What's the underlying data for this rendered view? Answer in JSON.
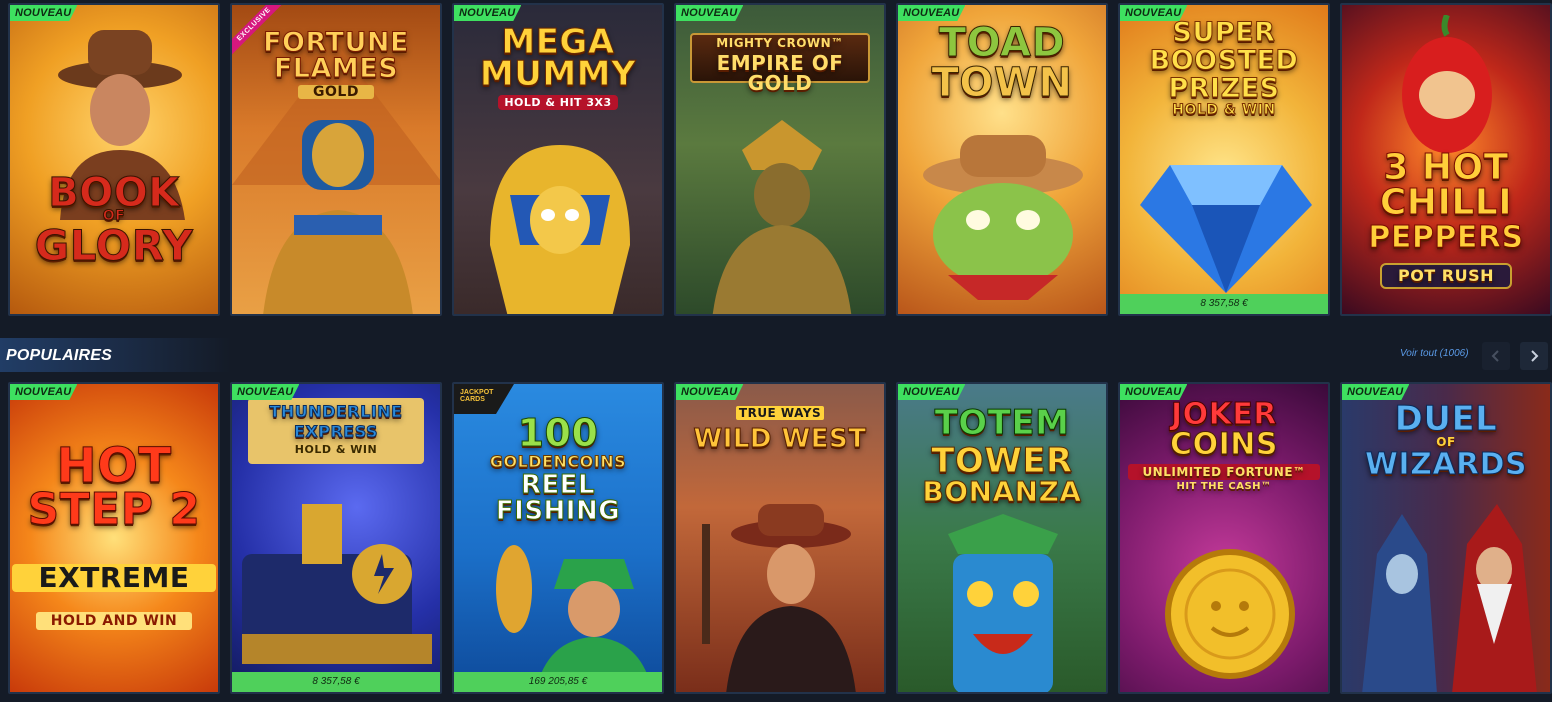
{
  "badge_new": "NOUVEAU",
  "exclusive_label": "EXCLUSIVE",
  "section": {
    "title": "POPULAIRES",
    "see_all": "Voir tout (1006)",
    "prev_icon": "chevron-left-icon",
    "next_icon": "chevron-right-icon"
  },
  "top_games": [
    {
      "title_1": "BOOK",
      "title_2": "OF",
      "title_3": "GLORY",
      "has_new": true
    },
    {
      "title_1": "FORTUNE",
      "title_2": "FLAMES",
      "title_3": "GOLD",
      "has_new": false,
      "exclusive": true
    },
    {
      "title_1": "MEGA",
      "title_2": "MUMMY",
      "title_3": "HOLD & HIT 3x3",
      "has_new": true
    },
    {
      "title_1": "MIGHTY CROWN™",
      "title_2": "EMPIRE OF GOLD",
      "has_new": true
    },
    {
      "title_1": "TOAD",
      "title_2": "TOWN",
      "has_new": true
    },
    {
      "title_1": "SUPER",
      "title_2": "BOOSTED",
      "title_3": "PRIZES",
      "title_4": "HOLD & WIN",
      "has_new": true,
      "jackpot": "8 357,58 €"
    },
    {
      "title_1": "3 HOT",
      "title_2": "CHILLI",
      "title_3": "PEPPERS",
      "title_4": "POT RUSH",
      "has_new": false
    }
  ],
  "bottom_games": [
    {
      "title_1": "HOT",
      "title_2": "STEP 2",
      "title_3": "EXTREME",
      "title_4": "HOLD AND WIN",
      "has_new": true
    },
    {
      "title_1": "THUNDERLINE",
      "title_2": "EXPRESS",
      "title_3": "HOLD & WIN",
      "has_new": true,
      "jackpot": "8 357,58 €"
    },
    {
      "title_1": "100",
      "title_2": "GOLDENCOINS",
      "title_3": "REEL",
      "title_4": "FISHING",
      "has_new": false,
      "corner": "JACKPOT CARDS",
      "jackpot": "169 205,85 €"
    },
    {
      "title_1": "TRUE WAYS",
      "title_2": "WILD WEST",
      "has_new": true
    },
    {
      "title_1": "TOTEM",
      "title_2": "TOWER",
      "title_3": "BONANZA",
      "has_new": true
    },
    {
      "title_1": "JOKER",
      "title_2": "COINS",
      "title_3": "UNLIMITED FORTUNE™",
      "title_4": "HIT THE CASH™",
      "has_new": true
    },
    {
      "title_1": "DUEL",
      "title_2": "OF",
      "title_3": "WIZARDS",
      "has_new": true
    }
  ]
}
